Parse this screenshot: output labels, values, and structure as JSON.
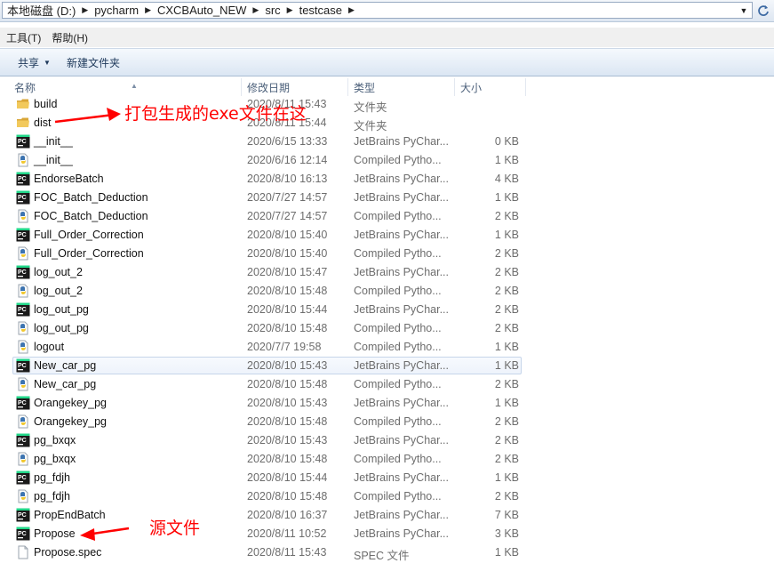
{
  "address": {
    "crumbs": [
      "本地磁盘 (D:)",
      "pycharm",
      "CXCBAuto_NEW",
      "src",
      "testcase"
    ]
  },
  "menu": {
    "items": [
      "工具(T)",
      "帮助(H)"
    ]
  },
  "toolbar": {
    "share_label": "共享",
    "new_folder_label": "新建文件夹"
  },
  "columns": {
    "name": "名称",
    "date": "修改日期",
    "type": "类型",
    "size": "大小"
  },
  "files": [
    {
      "name": "build",
      "date": "2020/8/11 15:43",
      "type": "文件夹",
      "size": "",
      "icon": "folder"
    },
    {
      "name": "dist",
      "date": "2020/8/11 15:44",
      "type": "文件夹",
      "size": "",
      "icon": "folder"
    },
    {
      "name": "__init__",
      "date": "2020/6/15 13:33",
      "type": "JetBrains PyChar...",
      "size": "0 KB",
      "icon": "pycharm"
    },
    {
      "name": "__init__",
      "date": "2020/6/16 12:14",
      "type": "Compiled Pytho...",
      "size": "1 KB",
      "icon": "pyc"
    },
    {
      "name": "EndorseBatch",
      "date": "2020/8/10 16:13",
      "type": "JetBrains PyChar...",
      "size": "4 KB",
      "icon": "pycharm"
    },
    {
      "name": "FOC_Batch_Deduction",
      "date": "2020/7/27 14:57",
      "type": "JetBrains PyChar...",
      "size": "1 KB",
      "icon": "pycharm"
    },
    {
      "name": "FOC_Batch_Deduction",
      "date": "2020/7/27 14:57",
      "type": "Compiled Pytho...",
      "size": "2 KB",
      "icon": "pyc"
    },
    {
      "name": "Full_Order_Correction",
      "date": "2020/8/10 15:40",
      "type": "JetBrains PyChar...",
      "size": "1 KB",
      "icon": "pycharm"
    },
    {
      "name": "Full_Order_Correction",
      "date": "2020/8/10 15:40",
      "type": "Compiled Pytho...",
      "size": "2 KB",
      "icon": "pyc"
    },
    {
      "name": "log_out_2",
      "date": "2020/8/10 15:47",
      "type": "JetBrains PyChar...",
      "size": "2 KB",
      "icon": "pycharm"
    },
    {
      "name": "log_out_2",
      "date": "2020/8/10 15:48",
      "type": "Compiled Pytho...",
      "size": "2 KB",
      "icon": "pyc"
    },
    {
      "name": "log_out_pg",
      "date": "2020/8/10 15:44",
      "type": "JetBrains PyChar...",
      "size": "2 KB",
      "icon": "pycharm"
    },
    {
      "name": "log_out_pg",
      "date": "2020/8/10 15:48",
      "type": "Compiled Pytho...",
      "size": "2 KB",
      "icon": "pyc"
    },
    {
      "name": "logout",
      "date": "2020/7/7 19:58",
      "type": "Compiled Pytho...",
      "size": "1 KB",
      "icon": "pyc"
    },
    {
      "name": "New_car_pg",
      "date": "2020/8/10 15:43",
      "type": "JetBrains PyChar...",
      "size": "1 KB",
      "icon": "pycharm"
    },
    {
      "name": "New_car_pg",
      "date": "2020/8/10 15:48",
      "type": "Compiled Pytho...",
      "size": "2 KB",
      "icon": "pyc"
    },
    {
      "name": "Orangekey_pg",
      "date": "2020/8/10 15:43",
      "type": "JetBrains PyChar...",
      "size": "1 KB",
      "icon": "pycharm"
    },
    {
      "name": "Orangekey_pg",
      "date": "2020/8/10 15:48",
      "type": "Compiled Pytho...",
      "size": "2 KB",
      "icon": "pyc"
    },
    {
      "name": "pg_bxqx",
      "date": "2020/8/10 15:43",
      "type": "JetBrains PyChar...",
      "size": "2 KB",
      "icon": "pycharm"
    },
    {
      "name": "pg_bxqx",
      "date": "2020/8/10 15:48",
      "type": "Compiled Pytho...",
      "size": "2 KB",
      "icon": "pyc"
    },
    {
      "name": "pg_fdjh",
      "date": "2020/8/10 15:44",
      "type": "JetBrains PyChar...",
      "size": "1 KB",
      "icon": "pycharm"
    },
    {
      "name": "pg_fdjh",
      "date": "2020/8/10 15:48",
      "type": "Compiled Pytho...",
      "size": "2 KB",
      "icon": "pyc"
    },
    {
      "name": "PropEndBatch",
      "date": "2020/8/10 16:37",
      "type": "JetBrains PyChar...",
      "size": "7 KB",
      "icon": "pycharm"
    },
    {
      "name": "Propose",
      "date": "2020/8/11 10:52",
      "type": "JetBrains PyChar...",
      "size": "3 KB",
      "icon": "pycharm"
    },
    {
      "name": "Propose.spec",
      "date": "2020/8/11 15:43",
      "type": "SPEC 文件",
      "size": "1 KB",
      "icon": "file"
    }
  ],
  "annotations": {
    "dist_note": "打包生成的exe文件在这",
    "source_note": "源文件"
  },
  "colors": {
    "annotation": "#ff0000",
    "pycharm_icon_bg": "#1a1a1a",
    "folder": "#e8b94a"
  }
}
